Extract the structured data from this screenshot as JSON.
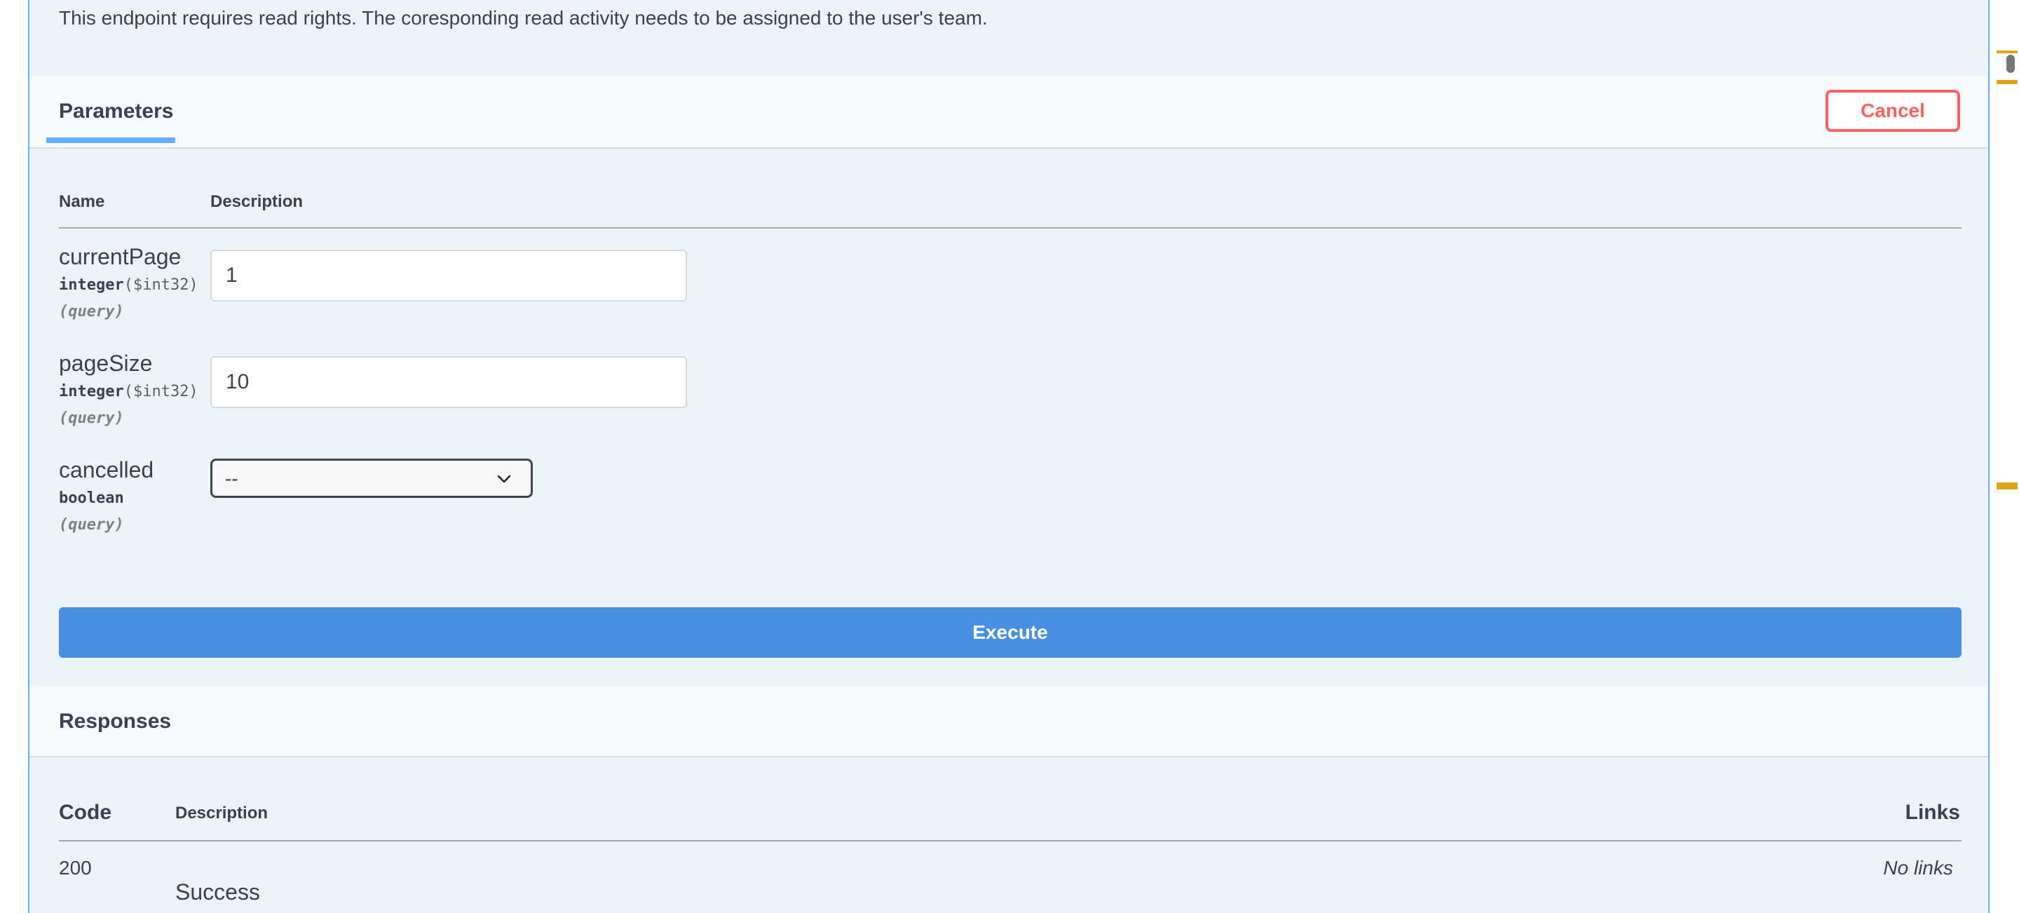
{
  "description": "This endpoint requires read rights. The coresponding read activity needs to be assigned to the user's team.",
  "parameters_section": {
    "title": "Parameters",
    "cancel_label": "Cancel",
    "columns": {
      "name": "Name",
      "description": "Description"
    },
    "params": [
      {
        "name": "currentPage",
        "type": "integer",
        "format": "($int32)",
        "in": "(query)",
        "value": "1"
      },
      {
        "name": "pageSize",
        "type": "integer",
        "format": "($int32)",
        "in": "(query)",
        "value": "10"
      },
      {
        "name": "cancelled",
        "type": "boolean",
        "in": "(query)",
        "selected": "--"
      }
    ],
    "execute_label": "Execute"
  },
  "responses_section": {
    "title": "Responses",
    "columns": {
      "code": "Code",
      "description": "Description",
      "links": "Links"
    },
    "rows": [
      {
        "code": "200",
        "description": "Success",
        "links": "No links"
      }
    ]
  },
  "colors": {
    "accent": "#61affe",
    "execute": "#4990e2",
    "cancel": "#ff6060",
    "marker": "#e0a418"
  },
  "icons": [
    "chevron-down-icon"
  ]
}
